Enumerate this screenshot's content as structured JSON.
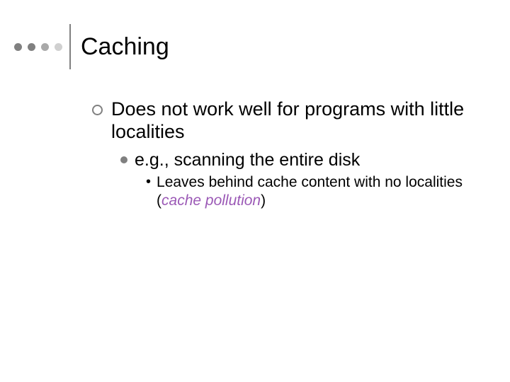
{
  "title": "Caching",
  "bullets": {
    "l1_text": "Does not work well for programs with little localities",
    "l2_text": "e.g., scanning the entire disk",
    "l3_prefix": "Leaves behind cache content with no localities (",
    "l3_term": "cache pollution",
    "l3_suffix": ")"
  }
}
